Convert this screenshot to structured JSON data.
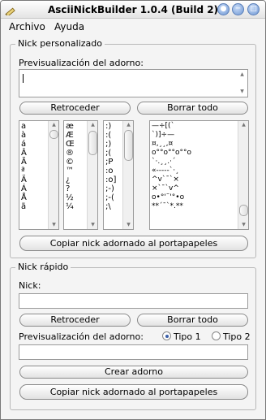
{
  "window": {
    "title": "AsciiNickBuilder 1.0.4 (Build 2)",
    "controls": [
      "circle-icon",
      "minimize-icon",
      "maximize-icon",
      "close-icon"
    ]
  },
  "menu": [
    "Archivo",
    "Ayuda"
  ],
  "custom": {
    "legend": "Nick personalizado",
    "preview_label": "Previsualización del adorno:",
    "preview_value": "",
    "back_label": "Retroceder",
    "clear_label": "Borrar todo",
    "copy_label": "Copiar nick adornado al portapapeles",
    "letters": [
      "a",
      "à",
      "á",
      "Â",
      "Ã",
      "ª",
      "Ä",
      "Á",
      "Å",
      "ã"
    ],
    "symbols": [
      "æ",
      "Æ",
      "Œ",
      "®",
      "©",
      "™",
      "¿",
      "?",
      "½",
      "¼"
    ],
    "emoticons": [
      ":)",
      ":(",
      ";)",
      ";(",
      ";P",
      ":o",
      ":o]",
      ";-)",
      ";-(",
      ";\\"
    ],
    "ornaments": [
      "—÷[(`",
      "`)]÷—",
      "¤,¸¸,¤",
      "o°°o°°o°°o",
      "`·.¸¸.·´",
      "«-----`·¸",
      "^v`¯`×",
      "×`¯`v^",
      "o•°'¨'°•o",
      "**´¯`*.**"
    ]
  },
  "quick": {
    "legend": "Nick rápido",
    "nick_label": "Nick:",
    "nick_value": "",
    "back_label": "Retroceder",
    "clear_label": "Borrar todo",
    "preview_label": "Previsualización del adorno:",
    "type1_label": "Tipo 1",
    "type2_label": "Tipo 2",
    "type_selected": "Tipo 1",
    "preview_value": "",
    "create_label": "Crear adorno",
    "copy_label": "Copiar nick adornado al portapapeles"
  }
}
